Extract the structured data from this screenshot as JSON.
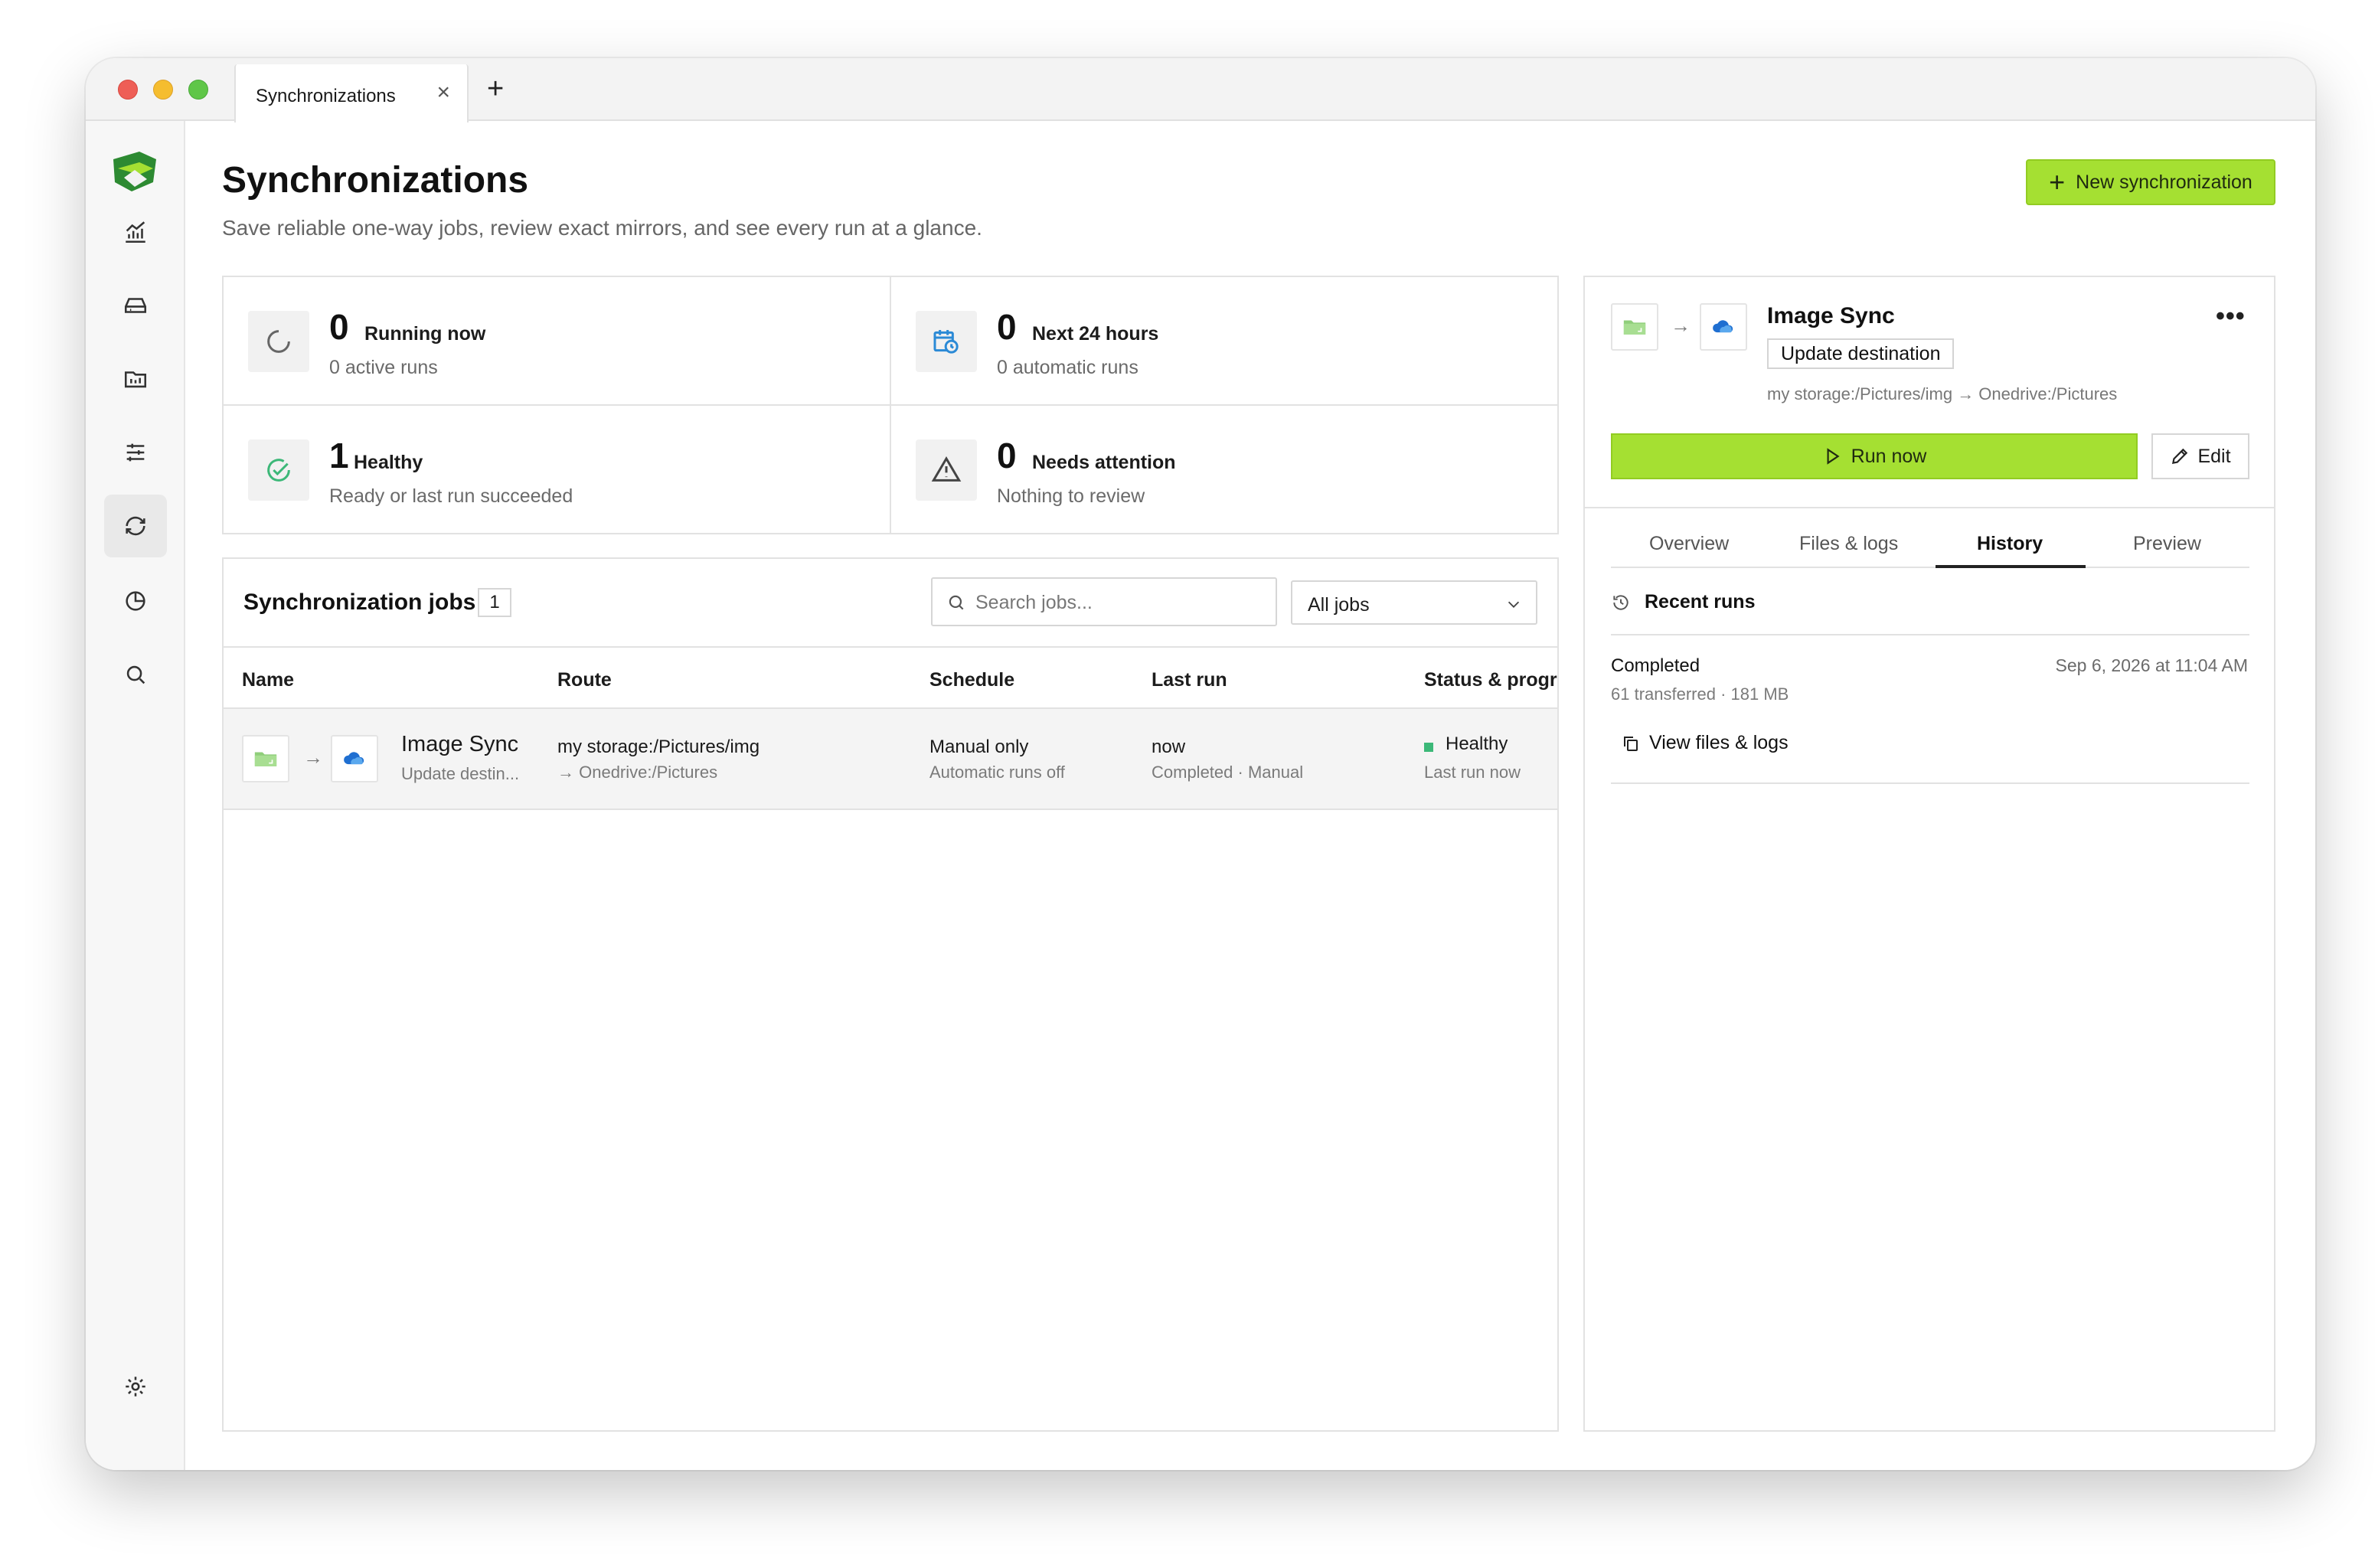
{
  "tab": {
    "label": "Synchronizations",
    "close": "×",
    "new": "+"
  },
  "page": {
    "title": "Synchronizations",
    "subtitle": "Save reliable one-way jobs, review exact mirrors, and see every run at a glance.",
    "new_button": "New synchronization"
  },
  "sidebar": {
    "items": [
      {
        "icon": "chart-icon"
      },
      {
        "icon": "drive-icon"
      },
      {
        "icon": "folder-icon"
      },
      {
        "icon": "sliders-icon"
      },
      {
        "icon": "sync-icon",
        "active": true
      },
      {
        "icon": "pie-chart-icon"
      },
      {
        "icon": "search-icon"
      },
      {
        "icon": "settings-icon"
      }
    ]
  },
  "stats": {
    "running": {
      "value": "0",
      "label": "Running now",
      "sub": "0 active runs"
    },
    "next24": {
      "value": "0",
      "label": "Next 24 hours",
      "sub": "0 automatic runs"
    },
    "healthy": {
      "value": "1",
      "label": "Healthy",
      "sub": "Ready or last run succeeded"
    },
    "attention": {
      "value": "0",
      "label": "Needs attention",
      "sub": "Nothing to review"
    }
  },
  "jobs": {
    "title": "Synchronization jobs",
    "count": "1",
    "search_placeholder": "Search jobs...",
    "filter": "All jobs",
    "columns": [
      "Name",
      "Route",
      "Schedule",
      "Last run",
      "Status & progre"
    ],
    "rows": [
      {
        "name": "Image Sync",
        "subtitle": "Update destin...",
        "route_main": "my storage:/Pictures/img",
        "route_sub": "→ Onedrive:/Pictures",
        "schedule_main": "Manual only",
        "schedule_sub": "Automatic runs off",
        "last_run_main": "now",
        "last_run_sub": "Completed · Manual",
        "status_main": "Healthy",
        "status_sub": "Last run now",
        "status_color": "#3cb878"
      }
    ]
  },
  "detail": {
    "title": "Image Sync",
    "badge": "Update destination",
    "route": "my storage:/Pictures/img → Onedrive:/Pictures",
    "more": "•••",
    "run_button": "Run now",
    "edit_button": "Edit",
    "tabs": [
      "Overview",
      "Files & logs",
      "History",
      "Preview"
    ],
    "active_tab": "History",
    "recent_title": "Recent runs",
    "run": {
      "status": "Completed",
      "date": "Sep 6, 2026 at 11:04 AM",
      "meta": "61 transferred · 181 MB",
      "view_link": "View files & logs"
    }
  },
  "colors": {
    "accent": "#a5e032",
    "healthy": "#3cb878",
    "onedrive": "#1f6fd1"
  }
}
